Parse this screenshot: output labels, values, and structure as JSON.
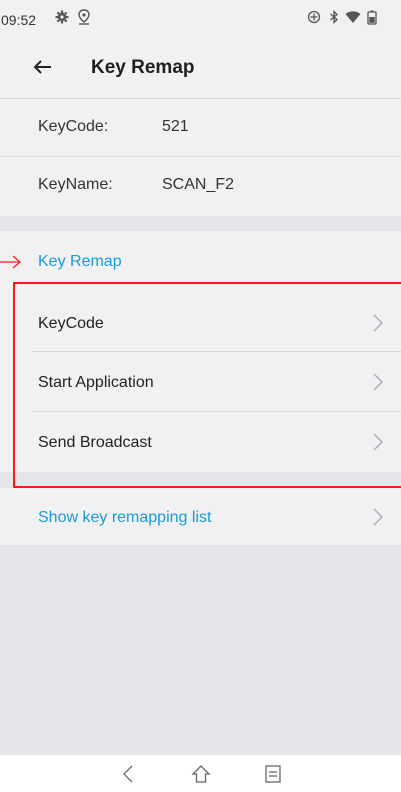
{
  "status_bar": {
    "time": "09:52",
    "icons": [
      "gear-icon",
      "location-pin-icon",
      "target-icon",
      "bluetooth-icon",
      "wifi-icon",
      "battery-icon"
    ]
  },
  "app_bar": {
    "title": "Key Remap",
    "back_icon": "arrow-left-icon"
  },
  "key_info": {
    "keycode_label": "KeyCode:",
    "keycode_value": "521",
    "keyname_label": "KeyName:",
    "keyname_value": "SCAN_F2"
  },
  "remap_section": {
    "header": "Key Remap",
    "items": [
      {
        "label": "KeyCode"
      },
      {
        "label": "Start Application"
      },
      {
        "label": "Send Broadcast"
      }
    ]
  },
  "list_link": {
    "label": "Show key remapping list"
  },
  "colors": {
    "accent": "#1a9ad8",
    "highlight": "#ff1a1a",
    "background": "#f1f1f4"
  }
}
